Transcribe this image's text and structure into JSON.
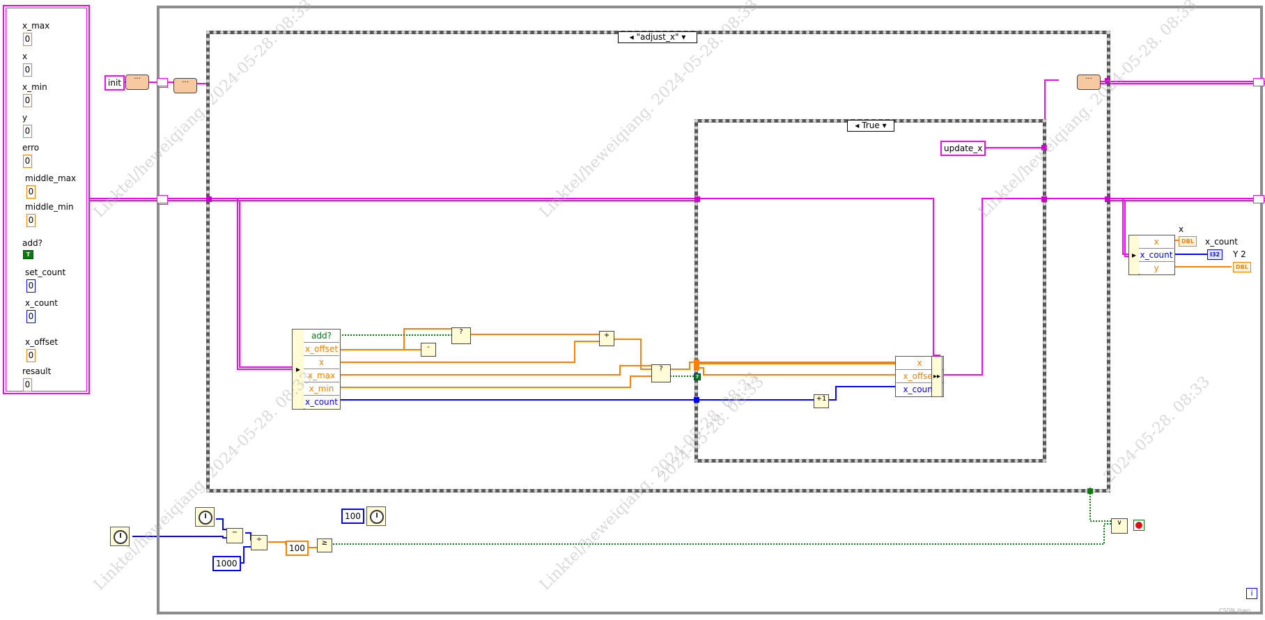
{
  "controls": [
    {
      "label": "x_max",
      "value": "0",
      "kind": "dbl"
    },
    {
      "label": "x",
      "value": "0",
      "kind": "dbl"
    },
    {
      "label": "x_min",
      "value": "0",
      "kind": "dbl"
    },
    {
      "label": "y",
      "value": "0",
      "kind": "dbl"
    },
    {
      "label": "erro",
      "value": "0",
      "kind": "dbl"
    },
    {
      "label": "middle_max",
      "value": "0",
      "kind": "dbl"
    },
    {
      "label": "middle_min",
      "value": "0",
      "kind": "dbl"
    },
    {
      "label": "add?",
      "value": "T",
      "kind": "bool"
    },
    {
      "label": "set_count",
      "value": "0",
      "kind": "i32"
    },
    {
      "label": "x_count",
      "value": "0",
      "kind": "i32"
    },
    {
      "label": "x_offset",
      "value": "0",
      "kind": "dbl"
    },
    {
      "label": "resault",
      "value": "0",
      "kind": "dbl"
    }
  ],
  "diagram": {
    "init_const": "init",
    "outer_case_selector": "\"adjust_x\"",
    "inner_case_selector": "True",
    "update_const": "update_x",
    "unbundle_left": [
      "add?",
      "x_offset",
      "x",
      "x_max",
      "x_min",
      "x_count"
    ],
    "bundle_inner": [
      "x",
      "x_offset",
      "x_count"
    ],
    "unbundle_right": [
      "x",
      "x_count",
      "y"
    ],
    "indicators": [
      {
        "label": "x",
        "type": "DBL"
      },
      {
        "label": "x_count",
        "type": "I32"
      },
      {
        "label": "Y 2",
        "type": "DBL"
      }
    ],
    "const_1000": "1000",
    "const_100_wait": "100",
    "const_100_cmp": "100",
    "iteration_label": "i",
    "op_add": "+",
    "op_inc": "+1",
    "op_sub": "−",
    "op_div": "÷",
    "op_ge": "≥",
    "op_or": "∨",
    "op_neg": "-",
    "op_select_true": "▸",
    "op_select_q": "?",
    "unbundle_arrow": "▸",
    "bundle_arrow": "▸▸",
    "selector_arrow_left": "◂",
    "selector_arrow_right": "▾",
    "icon_dots": "···",
    "bool_mini": "?",
    "bool_mini_true": "T"
  },
  "watermarks": [
    "Linktel/heweiqiang. 2024-05-28. 08:33",
    "Linktel/heweiqiang. 2024-05-28. 08:33",
    "Linktel/heweiqiang. 2024-05-28. 08:33",
    "Linktel/heweiqiang. 2024-05-28. 08:33",
    "Linktel/heweiqiang. 2024-05-28. 08:33",
    "2024-05-28. 08:33",
    "2024-05-28. 08:33"
  ],
  "footer": "CSDN @wo...",
  "colors": {
    "string": "#ff00ff",
    "dbl": "#ff7f00",
    "int": "#0000ff",
    "bool": "#0a7a0a"
  }
}
